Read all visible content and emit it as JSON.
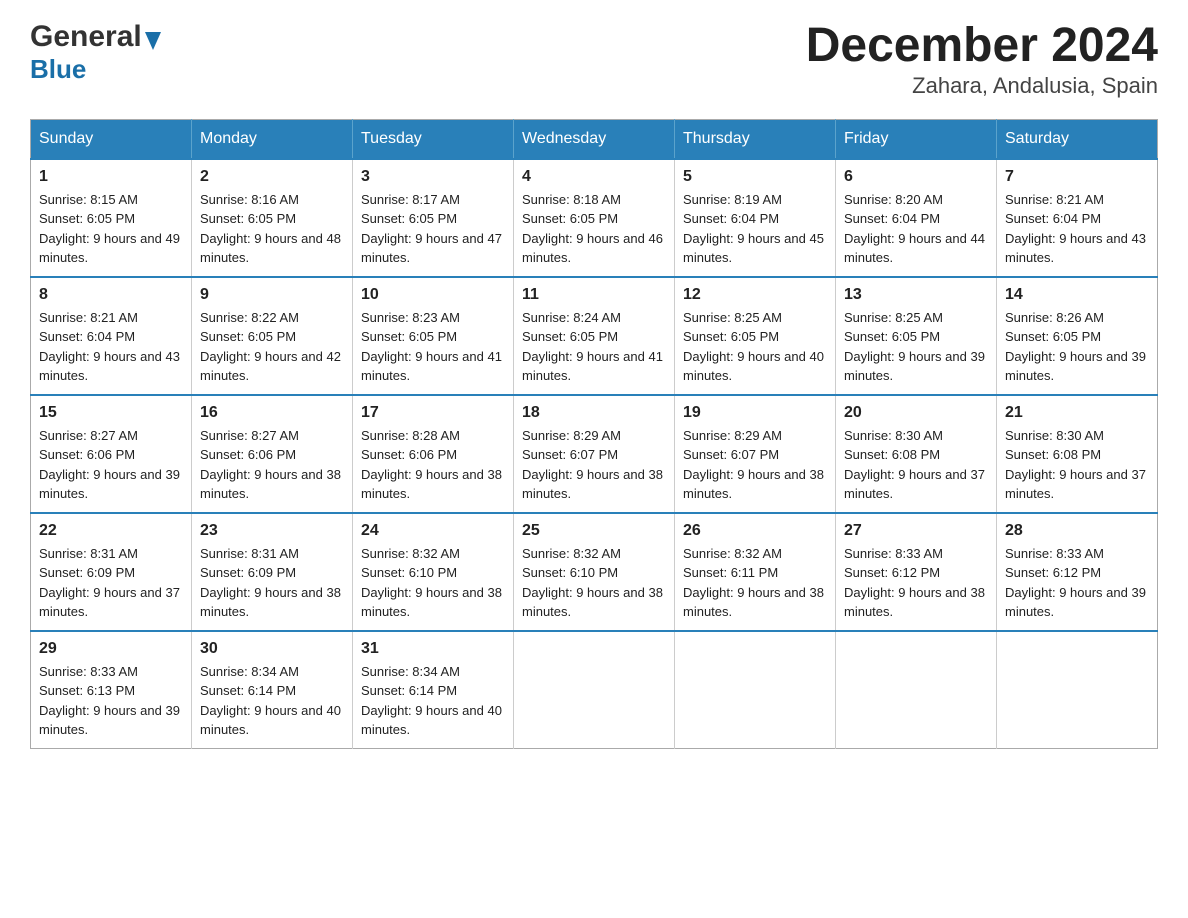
{
  "logo": {
    "general": "General",
    "blue": "Blue"
  },
  "title": "December 2024",
  "subtitle": "Zahara, Andalusia, Spain",
  "weekdays": [
    "Sunday",
    "Monday",
    "Tuesday",
    "Wednesday",
    "Thursday",
    "Friday",
    "Saturday"
  ],
  "weeks": [
    [
      {
        "day": "1",
        "sunrise": "8:15 AM",
        "sunset": "6:05 PM",
        "daylight": "9 hours and 49 minutes."
      },
      {
        "day": "2",
        "sunrise": "8:16 AM",
        "sunset": "6:05 PM",
        "daylight": "9 hours and 48 minutes."
      },
      {
        "day": "3",
        "sunrise": "8:17 AM",
        "sunset": "6:05 PM",
        "daylight": "9 hours and 47 minutes."
      },
      {
        "day": "4",
        "sunrise": "8:18 AM",
        "sunset": "6:05 PM",
        "daylight": "9 hours and 46 minutes."
      },
      {
        "day": "5",
        "sunrise": "8:19 AM",
        "sunset": "6:04 PM",
        "daylight": "9 hours and 45 minutes."
      },
      {
        "day": "6",
        "sunrise": "8:20 AM",
        "sunset": "6:04 PM",
        "daylight": "9 hours and 44 minutes."
      },
      {
        "day": "7",
        "sunrise": "8:21 AM",
        "sunset": "6:04 PM",
        "daylight": "9 hours and 43 minutes."
      }
    ],
    [
      {
        "day": "8",
        "sunrise": "8:21 AM",
        "sunset": "6:04 PM",
        "daylight": "9 hours and 43 minutes."
      },
      {
        "day": "9",
        "sunrise": "8:22 AM",
        "sunset": "6:05 PM",
        "daylight": "9 hours and 42 minutes."
      },
      {
        "day": "10",
        "sunrise": "8:23 AM",
        "sunset": "6:05 PM",
        "daylight": "9 hours and 41 minutes."
      },
      {
        "day": "11",
        "sunrise": "8:24 AM",
        "sunset": "6:05 PM",
        "daylight": "9 hours and 41 minutes."
      },
      {
        "day": "12",
        "sunrise": "8:25 AM",
        "sunset": "6:05 PM",
        "daylight": "9 hours and 40 minutes."
      },
      {
        "day": "13",
        "sunrise": "8:25 AM",
        "sunset": "6:05 PM",
        "daylight": "9 hours and 39 minutes."
      },
      {
        "day": "14",
        "sunrise": "8:26 AM",
        "sunset": "6:05 PM",
        "daylight": "9 hours and 39 minutes."
      }
    ],
    [
      {
        "day": "15",
        "sunrise": "8:27 AM",
        "sunset": "6:06 PM",
        "daylight": "9 hours and 39 minutes."
      },
      {
        "day": "16",
        "sunrise": "8:27 AM",
        "sunset": "6:06 PM",
        "daylight": "9 hours and 38 minutes."
      },
      {
        "day": "17",
        "sunrise": "8:28 AM",
        "sunset": "6:06 PM",
        "daylight": "9 hours and 38 minutes."
      },
      {
        "day": "18",
        "sunrise": "8:29 AM",
        "sunset": "6:07 PM",
        "daylight": "9 hours and 38 minutes."
      },
      {
        "day": "19",
        "sunrise": "8:29 AM",
        "sunset": "6:07 PM",
        "daylight": "9 hours and 38 minutes."
      },
      {
        "day": "20",
        "sunrise": "8:30 AM",
        "sunset": "6:08 PM",
        "daylight": "9 hours and 37 minutes."
      },
      {
        "day": "21",
        "sunrise": "8:30 AM",
        "sunset": "6:08 PM",
        "daylight": "9 hours and 37 minutes."
      }
    ],
    [
      {
        "day": "22",
        "sunrise": "8:31 AM",
        "sunset": "6:09 PM",
        "daylight": "9 hours and 37 minutes."
      },
      {
        "day": "23",
        "sunrise": "8:31 AM",
        "sunset": "6:09 PM",
        "daylight": "9 hours and 38 minutes."
      },
      {
        "day": "24",
        "sunrise": "8:32 AM",
        "sunset": "6:10 PM",
        "daylight": "9 hours and 38 minutes."
      },
      {
        "day": "25",
        "sunrise": "8:32 AM",
        "sunset": "6:10 PM",
        "daylight": "9 hours and 38 minutes."
      },
      {
        "day": "26",
        "sunrise": "8:32 AM",
        "sunset": "6:11 PM",
        "daylight": "9 hours and 38 minutes."
      },
      {
        "day": "27",
        "sunrise": "8:33 AM",
        "sunset": "6:12 PM",
        "daylight": "9 hours and 38 minutes."
      },
      {
        "day": "28",
        "sunrise": "8:33 AM",
        "sunset": "6:12 PM",
        "daylight": "9 hours and 39 minutes."
      }
    ],
    [
      {
        "day": "29",
        "sunrise": "8:33 AM",
        "sunset": "6:13 PM",
        "daylight": "9 hours and 39 minutes."
      },
      {
        "day": "30",
        "sunrise": "8:34 AM",
        "sunset": "6:14 PM",
        "daylight": "9 hours and 40 minutes."
      },
      {
        "day": "31",
        "sunrise": "8:34 AM",
        "sunset": "6:14 PM",
        "daylight": "9 hours and 40 minutes."
      },
      null,
      null,
      null,
      null
    ]
  ]
}
